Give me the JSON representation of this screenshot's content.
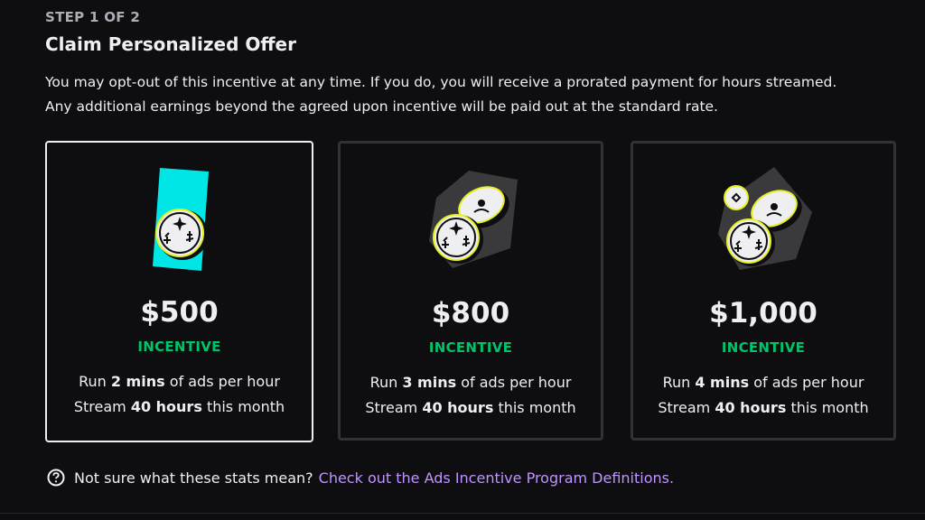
{
  "header": {
    "step": "STEP 1 OF 2",
    "title": "Claim Personalized Offer",
    "desc_line1": "You may opt-out of this incentive at any time. If you do, you will receive a prorated payment for hours streamed.",
    "desc_line2": "Any additional earnings beyond the agreed upon incentive will be paid out at the standard rate."
  },
  "offers": [
    {
      "amount": "$500",
      "label": "INCENTIVE",
      "selected": true,
      "icon": "coin-badge-illustration",
      "l1_pre": "Run",
      "l1_bold": "2 mins",
      "l1_post": "of ads per hour",
      "l2_pre": "Stream",
      "l2_bold": "40 hours",
      "l2_post": "this month"
    },
    {
      "amount": "$800",
      "label": "INCENTIVE",
      "selected": false,
      "icon": "coin-stack-illustration",
      "l1_pre": "Run",
      "l1_bold": "3 mins",
      "l1_post": "of ads per hour",
      "l2_pre": "Stream",
      "l2_bold": "40 hours",
      "l2_post": "this month"
    },
    {
      "amount": "$1,000",
      "label": "INCENTIVE",
      "selected": false,
      "icon": "coin-pile-illustration",
      "l1_pre": "Run",
      "l1_bold": "4 mins",
      "l1_post": "of ads per hour",
      "l2_pre": "Stream",
      "l2_bold": "40 hours",
      "l2_post": "this month"
    }
  ],
  "help": {
    "text": "Not sure what these stats mean?",
    "link": "Check out the Ads Incentive Program Definitions.",
    "icon": "question-circle-icon"
  },
  "colors": {
    "background": "#0e0e10",
    "accent_green": "#00c46c",
    "link_purple": "#bf94ff",
    "illustration_cyan": "#00e5e5",
    "coin_outline_yellow": "#e6f01f",
    "selected_border": "#efeff1",
    "card_border": "#323236"
  }
}
